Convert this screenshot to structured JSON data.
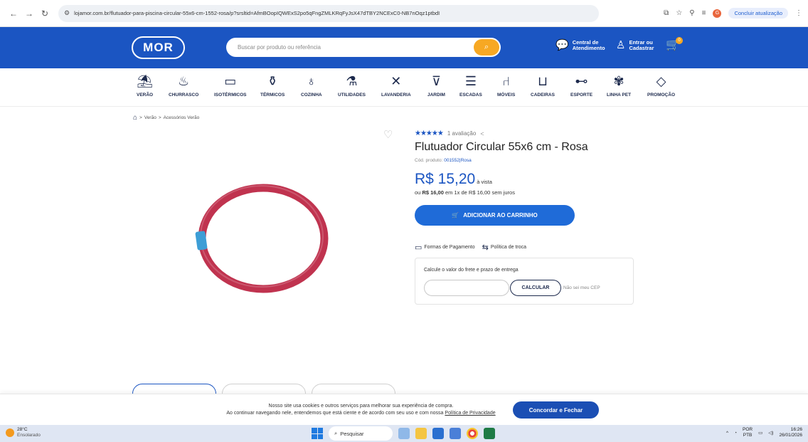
{
  "browser": {
    "url": "lojamor.com.br/flutuador-para-piscina-circular-55x6-cm-1552-rosa/p?srsltid=AfmBOopIQWExS2po5qFngZMLKRqFyJsX47dTBY2NCExC0-NB7nOqz1ptbdI",
    "update_label": "Concluir atualização",
    "profile_initial": "G"
  },
  "header": {
    "logo": "MOR",
    "search_placeholder": "Buscar por produto ou referência",
    "support_line1": "Central de",
    "support_line2": "Atendimento",
    "login_line1": "Entrar ou",
    "login_line2": "Cadastrar",
    "cart_count": "0"
  },
  "categories": [
    {
      "label": "VERÃO",
      "icon": "umbrella-icon",
      "glyph": "⛱"
    },
    {
      "label": "CHURRASCO",
      "icon": "grill-icon",
      "glyph": "♨"
    },
    {
      "label": "ISOTÉRMICOS",
      "icon": "cooler-icon",
      "glyph": "▭"
    },
    {
      "label": "TÉRMICOS",
      "icon": "thermos-icon",
      "glyph": "⚱"
    },
    {
      "label": "COZINHA",
      "icon": "pot-icon",
      "glyph": "♁"
    },
    {
      "label": "UTILIDADES",
      "icon": "bottle-icon",
      "glyph": "⚗"
    },
    {
      "label": "LAVANDERIA",
      "icon": "drying-rack-icon",
      "glyph": "✕"
    },
    {
      "label": "JARDIM",
      "icon": "planter-icon",
      "glyph": "⊽"
    },
    {
      "label": "ESCADAS",
      "icon": "ladder-icon",
      "glyph": "☰"
    },
    {
      "label": "MÓVEIS",
      "icon": "chair-icon",
      "glyph": "⑁"
    },
    {
      "label": "CADEIRAS",
      "icon": "beach-chair-icon",
      "glyph": "⊔"
    },
    {
      "label": "ESPORTE",
      "icon": "dumbbell-icon",
      "glyph": "⊷"
    },
    {
      "label": "LINHA PET",
      "icon": "paw-icon",
      "glyph": "✾"
    },
    {
      "label": "PROMOÇÃO",
      "icon": "tag-icon",
      "glyph": "◇"
    }
  ],
  "breadcrumb": {
    "items": [
      "Verão",
      "Acessórios Verão"
    ],
    "separator": ">"
  },
  "product": {
    "rating_stars": "★★★★★",
    "rating_count": "1 avaliação",
    "title": "Flutuador Circular 55x6 cm - Rosa",
    "code_label": "Cód. produto:",
    "code_value": "001552|Rosa",
    "price": "R$ 15,20",
    "price_suffix": "à vista",
    "installment_prefix": "ou",
    "installment_total": "R$ 16,00",
    "installment_rest": "em 1x de R$ 16,00 sem juros",
    "add_to_cart": "ADICIONAR AO CARRINHO",
    "payment_link": "Formas de Pagamento",
    "exchange_link": "Política de troca",
    "ring_color": "#c0334f",
    "tape_color": "#3d9ed6"
  },
  "shipping": {
    "title": "Calcule o valor do frete e prazo de entrega",
    "cep_value": "",
    "calc_label": "CALCULAR",
    "no_cep": "Não sei meu CEP"
  },
  "cookie": {
    "line1": "Nosso site usa cookies e outros serviços para melhorar sua experiência de compra.",
    "line2": "Ao continuar navegando nele, entendemos que está ciente e de acordo com seu uso e com nossa",
    "policy_link": "Política de Privacidade",
    "accept": "Concordar e Fechar"
  },
  "taskbar": {
    "temp": "28°C",
    "weather": "Ensolarado",
    "search": "Pesquisar",
    "lang1": "POR",
    "lang2": "PTB",
    "time": "16:26",
    "date": "26/01/2026"
  },
  "colors": {
    "brand_blue": "#1b55c2",
    "accent_orange": "#f7a823",
    "button_blue": "#1f6bd8"
  }
}
